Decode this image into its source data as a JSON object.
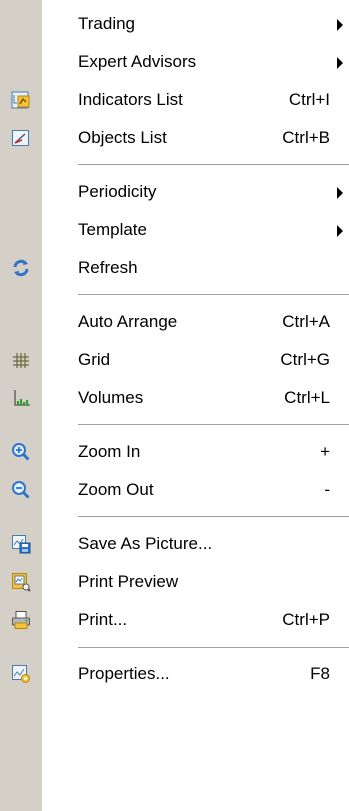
{
  "menu": {
    "items": [
      {
        "label": "Trading",
        "shortcut": "",
        "submenu": true,
        "icon": ""
      },
      {
        "label": "Expert Advisors",
        "shortcut": "",
        "submenu": true,
        "icon": ""
      },
      {
        "label": "Indicators List",
        "shortcut": "Ctrl+I",
        "submenu": false,
        "icon": "indicators-list-icon"
      },
      {
        "label": "Objects List",
        "shortcut": "Ctrl+B",
        "submenu": false,
        "icon": "objects-list-icon"
      },
      {
        "label": "Periodicity",
        "shortcut": "",
        "submenu": true,
        "icon": ""
      },
      {
        "label": "Template",
        "shortcut": "",
        "submenu": true,
        "icon": ""
      },
      {
        "label": "Refresh",
        "shortcut": "",
        "submenu": false,
        "icon": "refresh-icon"
      },
      {
        "label": "Auto Arrange",
        "shortcut": "Ctrl+A",
        "submenu": false,
        "icon": ""
      },
      {
        "label": "Grid",
        "shortcut": "Ctrl+G",
        "submenu": false,
        "icon": "grid-icon"
      },
      {
        "label": "Volumes",
        "shortcut": "Ctrl+L",
        "submenu": false,
        "icon": "volumes-icon"
      },
      {
        "label": "Zoom In",
        "shortcut": "+",
        "submenu": false,
        "icon": "zoom-in-icon"
      },
      {
        "label": "Zoom Out",
        "shortcut": "-",
        "submenu": false,
        "icon": "zoom-out-icon"
      },
      {
        "label": "Save As Picture...",
        "shortcut": "",
        "submenu": false,
        "icon": "save-as-picture-icon"
      },
      {
        "label": "Print Preview",
        "shortcut": "",
        "submenu": false,
        "icon": "print-preview-icon"
      },
      {
        "label": "Print...",
        "shortcut": "Ctrl+P",
        "submenu": false,
        "icon": "print-icon"
      },
      {
        "label": "Properties...",
        "shortcut": "F8",
        "submenu": false,
        "icon": "properties-icon"
      }
    ]
  },
  "colors": {
    "gutter": "#d4d0c8",
    "background": "#ffffff",
    "separator": "#a0a0a0"
  }
}
